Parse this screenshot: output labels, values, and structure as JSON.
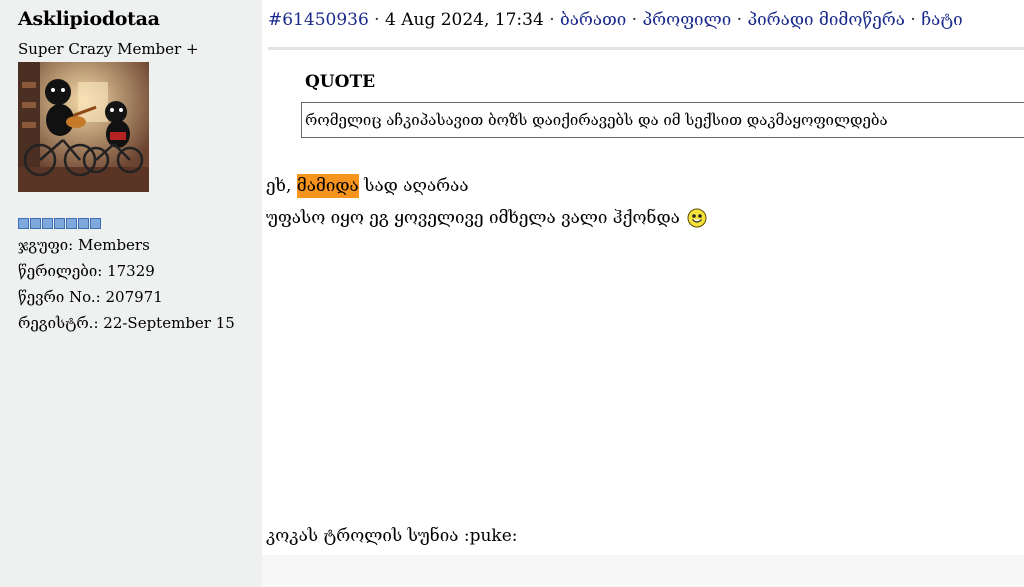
{
  "author": {
    "username": "Asklipiodotaa",
    "rank": "Super Crazy Member +",
    "pip_count": 7,
    "group": "ჯგუფი: Members",
    "posts": "წერილები: 17329",
    "member_no": "წევრი No.: 207971",
    "registered": "რეგისტრ.: 22-September 15"
  },
  "post": {
    "id_link": "#61450936",
    "sep1": " · ",
    "date": "4 Aug 2024, 17:34",
    "sep2": " · ",
    "link_rate": "ბარათი",
    "sep3": " · ",
    "link_profile": "პროფილი",
    "sep4": " · ",
    "link_pm": "პირადი მიმოწერა",
    "sep5": " · ",
    "link_chat": "ჩატი",
    "quote_label": "QUOTE",
    "quote_text": "რომელიც აჩკიპასავით ბოზს დაიქირავებს და იმ სექსით დაკმაყოფილდება",
    "line1_prefix": "ეხ, ",
    "line1_highlight": "მამიდა",
    "line1_suffix": " სად აღარაა",
    "line2": "უფასო იყო ეგ ყოველივე იმხელა ვალი ჰქონდა",
    "signature": "კოკას ტროლის სუნია :puke:"
  },
  "colors": {
    "link": "#1a2a8a",
    "highlight": "#f7941d",
    "pip": "#7fa9dd"
  },
  "icons": {
    "smiley": "smiley-icon"
  }
}
